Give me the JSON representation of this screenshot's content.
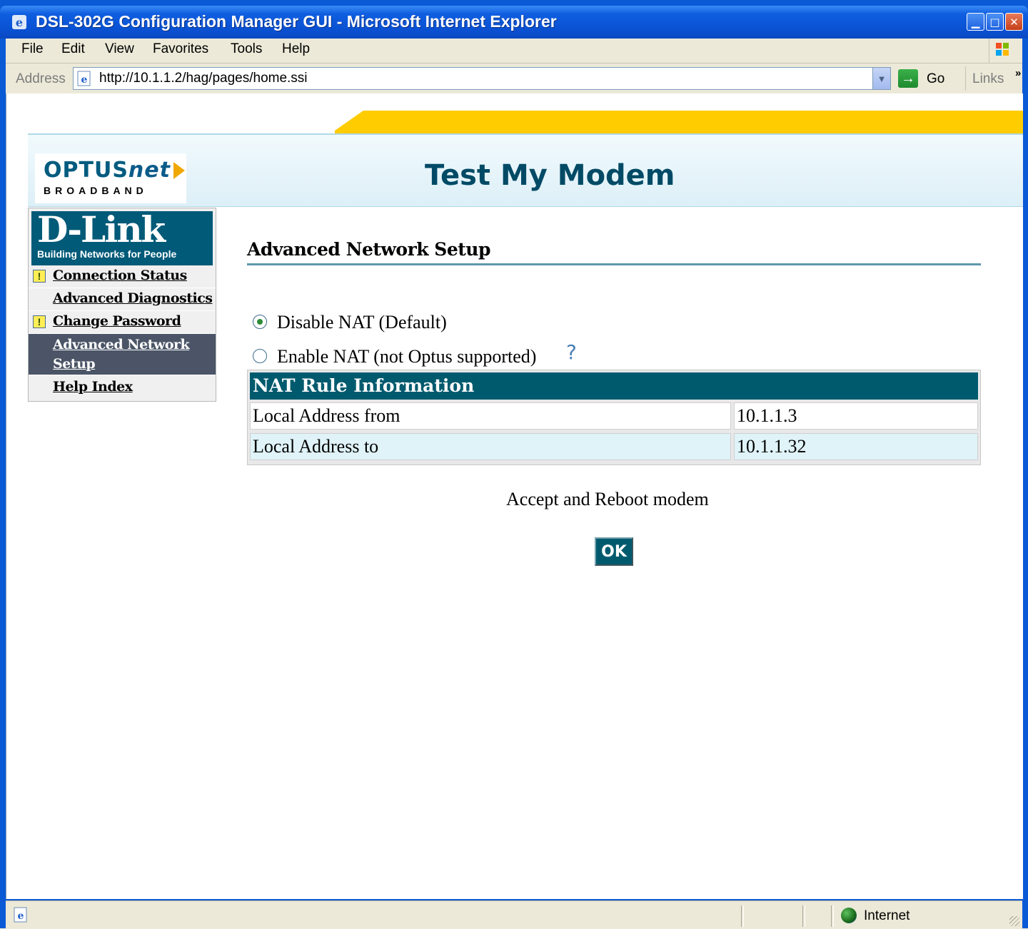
{
  "window": {
    "title": "DSL-302G Configuration Manager GUI - Microsoft Internet Explorer"
  },
  "menubar": {
    "items": [
      "File",
      "Edit",
      "View",
      "Favorites",
      "Tools",
      "Help"
    ]
  },
  "addressbar": {
    "label": "Address",
    "url": "http://10.1.1.2/hag/pages/home.ssi",
    "go_label": "Go",
    "links_label": "Links",
    "links_chevron": "»"
  },
  "banner": {
    "brand_top": "OPTUS",
    "brand_top_italic": "net",
    "brand_bottom": "BROADBAND",
    "heading": "Test My Modem"
  },
  "sidebar": {
    "logo_main": "D-Link",
    "logo_sub": "Building Networks for People",
    "items": [
      {
        "label": "Connection Status",
        "warning": true
      },
      {
        "label": "Advanced Diagnostics",
        "warning": false
      },
      {
        "label": "Change Password",
        "warning": true
      },
      {
        "label": "Advanced Network Setup",
        "warning": false,
        "active": true
      },
      {
        "label": "Help Index",
        "warning": false
      }
    ],
    "warning_glyph": "!"
  },
  "main": {
    "section_title": "Advanced Network Setup",
    "options": [
      {
        "label": "Disable NAT (Default)",
        "selected": true
      },
      {
        "label": "Enable NAT (not Optus supported)",
        "selected": false
      }
    ],
    "help_glyph": "?",
    "nat_table": {
      "header": "NAT Rule Information",
      "rows": [
        {
          "label": "Local Address from",
          "value": "10.1.1.3"
        },
        {
          "label": "Local Address to",
          "value": "10.1.1.32"
        }
      ]
    },
    "accept_text": "Accept and Reboot modem",
    "ok_label": "OK"
  },
  "statusbar": {
    "zone": "Internet"
  },
  "colors": {
    "titlebar": "#0a52d4",
    "banner_yellow": "#ffcc00",
    "dlink_blue": "#005a78",
    "nat_header": "#005a6e",
    "active_nav": "#4b5567"
  }
}
